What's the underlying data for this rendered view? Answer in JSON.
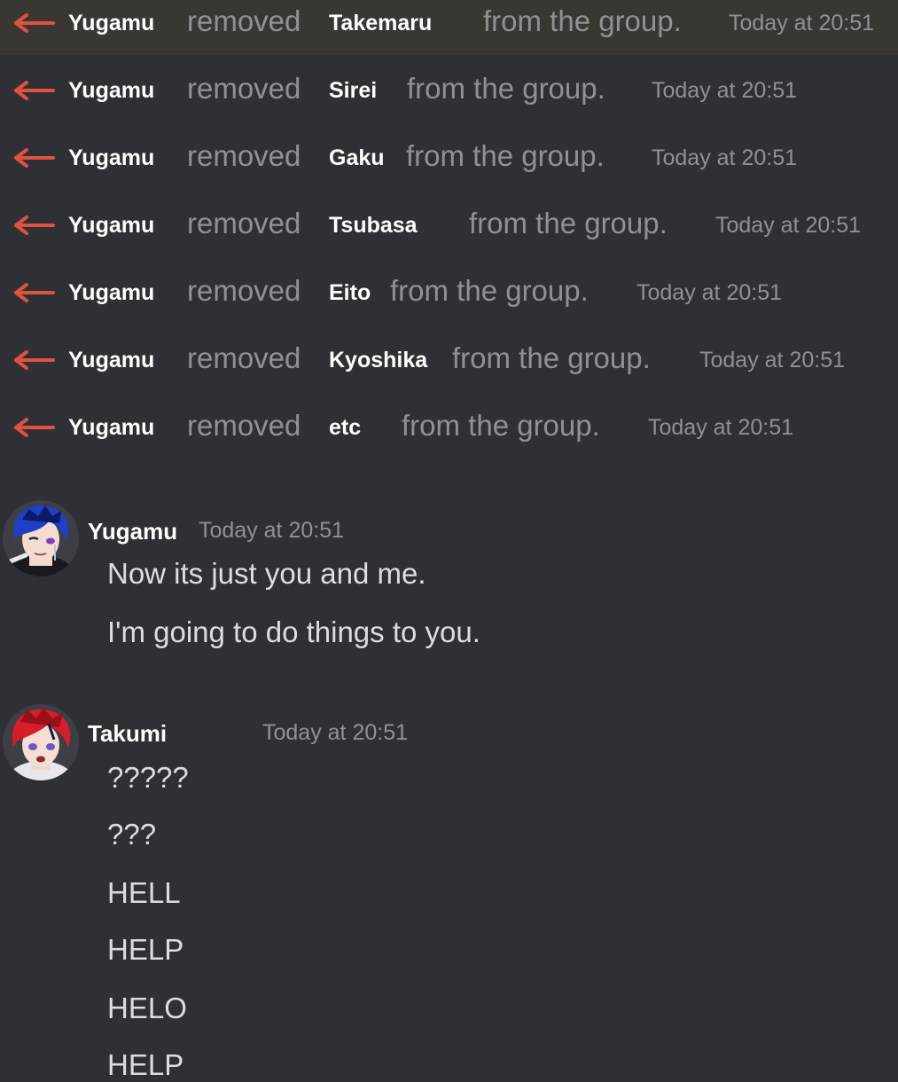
{
  "system_messages": [
    {
      "actor": "Yugamu",
      "verb": "removed",
      "target": "Takemaru",
      "suffix": "from the group.",
      "timestamp": "Today at 20:51"
    },
    {
      "actor": "Yugamu",
      "verb": "removed",
      "target": "Sirei",
      "suffix": "from the group.",
      "timestamp": "Today at 20:51"
    },
    {
      "actor": "Yugamu",
      "verb": "removed",
      "target": "Gaku",
      "suffix": "from the group.",
      "timestamp": "Today at 20:51"
    },
    {
      "actor": "Yugamu",
      "verb": "removed",
      "target": "Tsubasa",
      "suffix": "from the group.",
      "timestamp": "Today at 20:51"
    },
    {
      "actor": "Yugamu",
      "verb": "removed",
      "target": "Eito",
      "suffix": "from the group.",
      "timestamp": "Today at 20:51"
    },
    {
      "actor": "Yugamu",
      "verb": "removed",
      "target": "Kyoshika",
      "suffix": "from the group.",
      "timestamp": "Today at 20:51"
    },
    {
      "actor": "Yugamu",
      "verb": "removed",
      "target": "etc",
      "suffix": "from the group.",
      "timestamp": "Today at 20:51"
    }
  ],
  "messages": [
    {
      "author": "Yugamu",
      "timestamp": "Today at 20:51",
      "lines": [
        "Now its just you and me.",
        "I'm going to do things to you."
      ]
    },
    {
      "author": "Takumi",
      "timestamp": "Today at 20:51",
      "lines": [
        "?????",
        "???",
        "HELL",
        "HELP",
        "HELO",
        "HELP"
      ]
    }
  ],
  "icons": {
    "system_row": "arrow-left-icon",
    "avatar_yugamu": "avatar-blue-hair",
    "avatar_takumi": "avatar-red-hair"
  },
  "colors": {
    "background": "#2f3035",
    "removal_arrow": "#e0523f",
    "username": "#ffffff",
    "muted_text": "#8f9196",
    "message_text": "#dcdde1"
  }
}
